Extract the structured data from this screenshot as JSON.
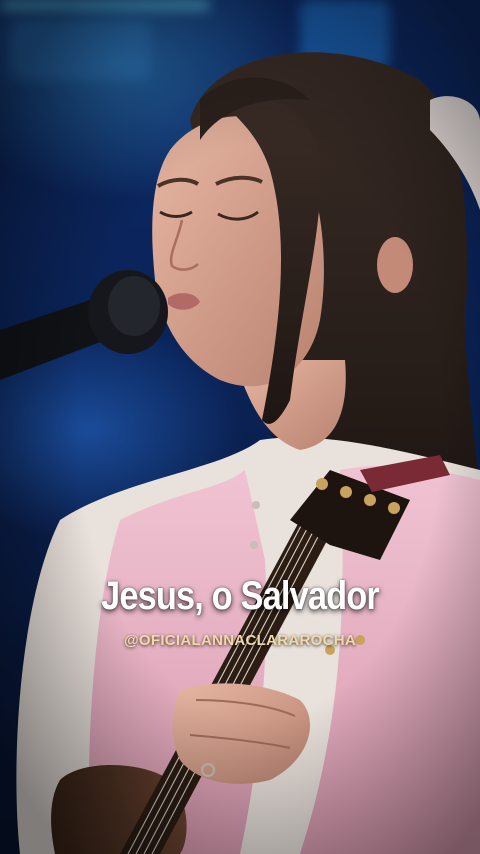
{
  "overlay": {
    "song_title": "Jesus, o Salvador",
    "artist_handle": "@OFICIALANNACLARAROCHA"
  },
  "scene": {
    "description_icon": "singer-with-guitar-photo",
    "colors": {
      "background": "#0a2358",
      "shirt_pink": "#e8b9c9",
      "blouse_white": "#eee6e0",
      "title_text": "#ffffff",
      "handle_text": "#f3d9a4"
    }
  }
}
